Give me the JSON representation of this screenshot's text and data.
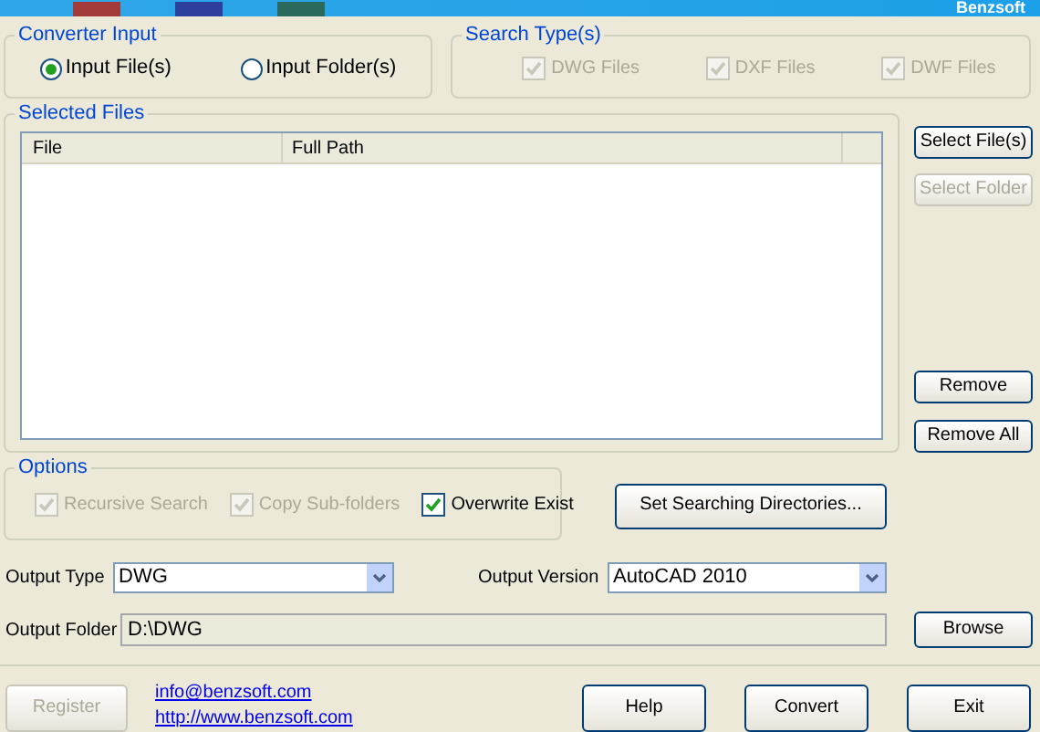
{
  "banner": {
    "brand": "Benzsoft"
  },
  "converter_input": {
    "title": "Converter Input",
    "options": [
      {
        "label": "Input File(s)",
        "selected": true
      },
      {
        "label": "Input Folder(s)",
        "selected": false
      }
    ]
  },
  "search_types": {
    "title": "Search Type(s)",
    "items": [
      {
        "label": "DWG Files",
        "checked": true,
        "disabled": true
      },
      {
        "label": "DXF Files",
        "checked": true,
        "disabled": true
      },
      {
        "label": "DWF Files",
        "checked": true,
        "disabled": true
      }
    ]
  },
  "selected_files": {
    "title": "Selected Files",
    "columns": [
      "File",
      "Full Path"
    ]
  },
  "file_buttons": [
    {
      "label": "Select File(s)",
      "disabled": false
    },
    {
      "label": "Select Folder",
      "disabled": true
    },
    {
      "label": "Remove",
      "disabled": false
    },
    {
      "label": "Remove All",
      "disabled": false
    }
  ],
  "options": {
    "title": "Options",
    "items": [
      {
        "label": "Recursive Search",
        "checked": true,
        "disabled": true
      },
      {
        "label": "Copy Sub-folders",
        "checked": true,
        "disabled": true
      },
      {
        "label": "Overwrite Exist",
        "checked": true,
        "disabled": false
      }
    ],
    "button": "Set Searching Directories..."
  },
  "output_type": {
    "label": "Output Type",
    "value": "DWG"
  },
  "output_version": {
    "label": "Output Version",
    "value": "AutoCAD 2010"
  },
  "output_folder": {
    "label": "Output Folder",
    "value": "D:\\DWG",
    "button": "Browse"
  },
  "footer": {
    "register": {
      "label": "Register",
      "disabled": true
    },
    "links": [
      "info@benzsoft.com",
      "http://www.benzsoft.com"
    ],
    "buttons": [
      {
        "label": "Help"
      },
      {
        "label": "Convert"
      },
      {
        "label": "Exit"
      }
    ]
  }
}
